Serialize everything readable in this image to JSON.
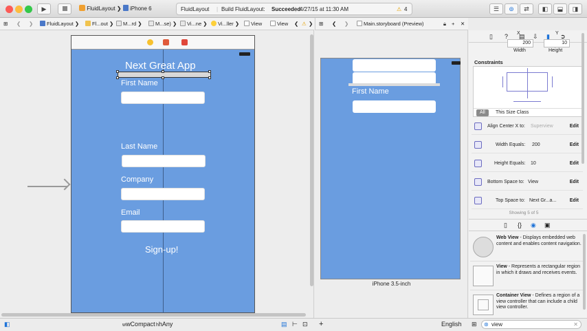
{
  "toolbar": {
    "scheme_app": "FluidLayout",
    "scheme_device": "iPhone 6",
    "activity_project": "FluidLayout",
    "activity_status_prefix": "Build FluidLayout:",
    "activity_status": "Succeeded",
    "activity_time": "4/27/15 at 11:30 AM",
    "warning_count": "4"
  },
  "jumpbar_left": {
    "items": [
      "FluidLayout",
      "Fl...out",
      "M...rd",
      "M...se)",
      "Vi...ne",
      "Vi...ller",
      "View"
    ]
  },
  "jumpbar_right": {
    "title": "Main.storyboard (Preview)"
  },
  "canvas": {
    "app_title": "Next Great App",
    "label_first": "First Name",
    "label_last": "Last Name",
    "label_company": "Company",
    "label_email": "Email",
    "signup": "Sign-up!"
  },
  "preview": {
    "label_first": "First Name",
    "device_name": "iPhone 3.5-inch"
  },
  "inspector": {
    "x_label": "X",
    "y_label": "Y",
    "width_value": "200",
    "height_value": "10",
    "width_label": "Width",
    "height_label": "Height",
    "constraints_title": "Constraints",
    "all_button": "All",
    "size_class_text": "This Size Class",
    "constraints": [
      {
        "label": "Align Center X to:",
        "value": "Superview",
        "edit": "Edit"
      },
      {
        "label": "Width Equals:",
        "value": "200",
        "edit": "Edit"
      },
      {
        "label": "Height Equals:",
        "value": "10",
        "edit": "Edit"
      },
      {
        "label": "Bottom Space to:",
        "value": "View",
        "edit": "Edit"
      },
      {
        "label": "Top Space to:",
        "value": "Next Gr...a...",
        "edit": "Edit"
      }
    ],
    "showing": "Showing 5 of 5",
    "library": [
      {
        "name": "Web View",
        "desc": " - Displays embedded web content and enables content navigation."
      },
      {
        "name": "View",
        "desc": " - Represents a rectangular region in which it draws and receives events."
      },
      {
        "name": "Container View",
        "desc": " - Defines a region of a view controller that can include a child view controller."
      }
    ],
    "filter_value": "view"
  },
  "bottom": {
    "size_w": "wCompact",
    "size_h": "hAny",
    "language": "English"
  },
  "colors": {
    "canvas_blue": "#6a9de0",
    "accent": "#1e73d8",
    "constraint_purple": "#6a6ac0"
  }
}
